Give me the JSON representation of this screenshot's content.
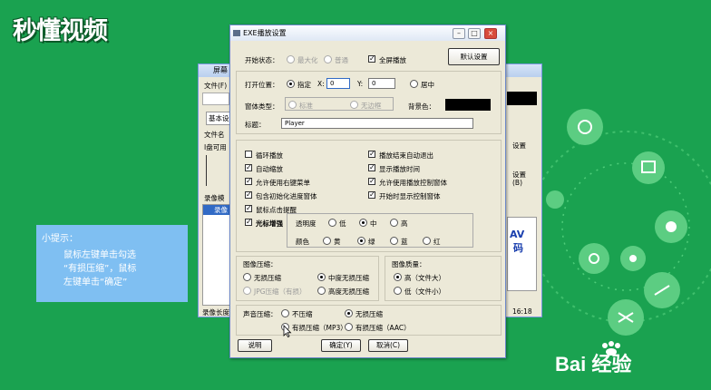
{
  "brand": {
    "logo_text": "秒懂视频",
    "footer_text": "Bai 经验"
  },
  "tip": {
    "title": "小提示：",
    "body": "鼠标左键单击勾选\n“有损压缩”，鼠标\n左键单击“确定”"
  },
  "back_window": {
    "title": "屏幕",
    "menu": "文件(F)",
    "tab": "基本设",
    "file_label": "文件名",
    "drive_label": "I盘可用",
    "list_header": "录像模",
    "list_item": "录像",
    "status": "录像长度",
    "right_texts": [
      "设置",
      "设置",
      "(B)",
      "AV",
      "码",
      "16:18"
    ]
  },
  "dialog": {
    "title": "EXE播放设置",
    "start_state": {
      "label": "开始状态：",
      "options": [
        "最大化",
        "普通"
      ],
      "fullscreen_label": "全屏播放",
      "fullscreen_checked": true
    },
    "default_button": "默认设置",
    "open_pos": {
      "label": "打开位置：",
      "specified_label": "指定",
      "x_label": "X:",
      "x_value": "0",
      "y_label": "Y:",
      "y_value": "0",
      "center_label": "居中"
    },
    "window_type": {
      "label": "窗体类型：",
      "options": [
        "标准",
        "无边框"
      ],
      "bg_label": "背景色："
    },
    "caption": {
      "label": "标题：",
      "value": "Player"
    },
    "checks": [
      {
        "label": "循环播放",
        "checked": false
      },
      {
        "label": "播放结束自动退出",
        "checked": true
      },
      {
        "label": "自动缩放",
        "checked": true
      },
      {
        "label": "显示播放时间",
        "checked": true
      },
      {
        "label": "允许使用右键菜单",
        "checked": true
      },
      {
        "label": "允许使用播放控制窗体",
        "checked": true
      },
      {
        "label": "包含初始化进度窗体",
        "checked": true
      },
      {
        "label": "开始时显示控制窗体",
        "checked": true
      },
      {
        "label": "鼠标点击提醒",
        "checked": true
      }
    ],
    "cursor_enhance": {
      "label": "光标增强",
      "checked": true,
      "opacity_label": "透明度",
      "opacity_options": [
        "低",
        "中",
        "高"
      ],
      "opacity_selected": "中",
      "color_label": "颜色",
      "color_options": [
        "黄",
        "绿",
        "蓝",
        "红"
      ],
      "color_selected": "绿"
    },
    "image_compress": {
      "label": "图像压缩：",
      "options": [
        "无损压缩",
        "中度无损压缩",
        "JPG压缩（有损）",
        "高度无损压缩"
      ],
      "selected": "中度无损压缩"
    },
    "image_quality": {
      "label": "图像质量：",
      "options": [
        "高（文件大）",
        "低（文件小）"
      ],
      "selected": "高（文件大）"
    },
    "audio_compress": {
      "label": "声音压缩：",
      "options": [
        "不压缩",
        "无损压缩",
        "有损压缩（MP3）",
        "有损压缩（AAC）"
      ],
      "selected": "无损压缩"
    },
    "buttons": {
      "help": "说明",
      "ok": "确定(Y)",
      "cancel": "取消(C)"
    }
  }
}
